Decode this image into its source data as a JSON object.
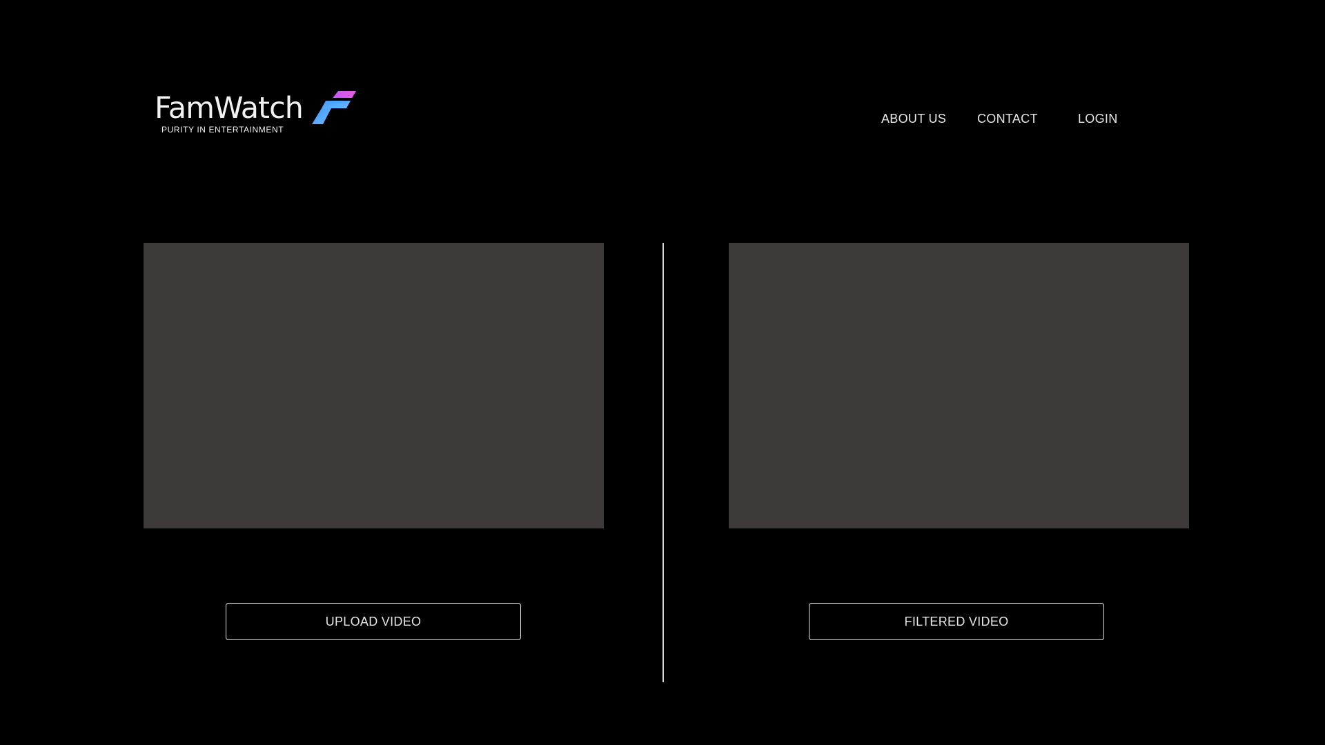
{
  "brand": {
    "name": "FamWatch",
    "tagline": "PURITY IN ENTERTAINMENT",
    "logo_icon": "famwatch-f-logo-icon",
    "logo_colors": {
      "top": "#d65cf2",
      "bottom": "#4da3ff"
    }
  },
  "nav": {
    "about": "ABOUT US",
    "contact": "CONTACT",
    "login": "LOGIN"
  },
  "panels": {
    "left_color": "#3e3a39",
    "right_color": "#3e3a39"
  },
  "buttons": {
    "upload": "UPLOAD VIDEO",
    "filtered": "FILTERED VIDEO"
  },
  "colors": {
    "background": "#000000",
    "text": "#e6e6e6",
    "divider": "#d9d9d9"
  }
}
